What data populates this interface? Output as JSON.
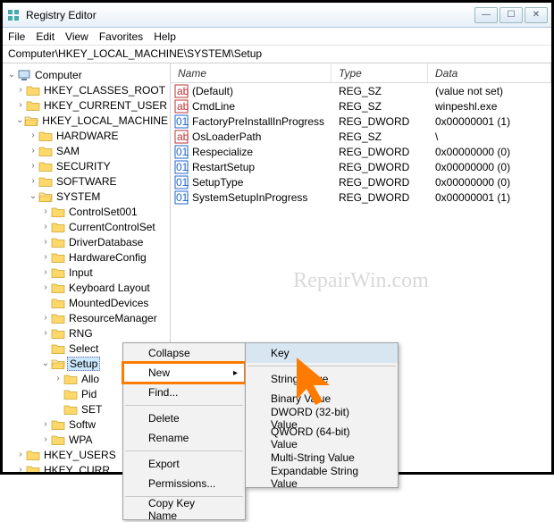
{
  "title": "Registry Editor",
  "menu": [
    "File",
    "Edit",
    "View",
    "Favorites",
    "Help"
  ],
  "path": "Computer\\HKEY_LOCAL_MACHINE\\SYSTEM\\Setup",
  "tree": {
    "root": "Computer",
    "k0": "HKEY_CLASSES_ROOT",
    "k1": "HKEY_CURRENT_USER",
    "k2": "HKEY_LOCAL_MACHINE",
    "k2a": "HARDWARE",
    "k2b": "SAM",
    "k2c": "SECURITY",
    "k2d": "SOFTWARE",
    "k2e": "SYSTEM",
    "s0": "ControlSet001",
    "s1": "CurrentControlSet",
    "s2": "DriverDatabase",
    "s3": "HardwareConfig",
    "s4": "Input",
    "s5": "Keyboard Layout",
    "s6": "MountedDevices",
    "s7": "ResourceManager",
    "s8": "RNG",
    "s9": "Select",
    "s10": "Setup",
    "s10a": "Allo",
    "s10b": "Pid",
    "s10c": "SET",
    "s11": "Softw",
    "s12": "WPA",
    "k3": "HKEY_USERS",
    "k4": "HKEY_CURR"
  },
  "cols": {
    "c1": "Name",
    "c2": "Type",
    "c3": "Data"
  },
  "rows": [
    {
      "ic": "str",
      "n": "(Default)",
      "t": "REG_SZ",
      "d": "(value not set)"
    },
    {
      "ic": "str",
      "n": "CmdLine",
      "t": "REG_SZ",
      "d": "winpeshl.exe"
    },
    {
      "ic": "bin",
      "n": "FactoryPreInstallInProgress",
      "t": "REG_DWORD",
      "d": "0x00000001 (1)"
    },
    {
      "ic": "str",
      "n": "OsLoaderPath",
      "t": "REG_SZ",
      "d": "\\"
    },
    {
      "ic": "bin",
      "n": "Respecialize",
      "t": "REG_DWORD",
      "d": "0x00000000 (0)"
    },
    {
      "ic": "bin",
      "n": "RestartSetup",
      "t": "REG_DWORD",
      "d": "0x00000000 (0)"
    },
    {
      "ic": "bin",
      "n": "SetupType",
      "t": "REG_DWORD",
      "d": "0x00000000 (0)"
    },
    {
      "ic": "bin",
      "n": "SystemSetupInProgress",
      "t": "REG_DWORD",
      "d": "0x00000001 (1)"
    }
  ],
  "ctx1": {
    "i0": "Collapse",
    "i1": "New",
    "i2": "Find...",
    "i3": "Delete",
    "i4": "Rename",
    "i5": "Export",
    "i6": "Permissions...",
    "i7": "Copy Key Name"
  },
  "ctx2": {
    "i0": "Key",
    "i1": "String Value",
    "i2": "Binary Value",
    "i3": "DWORD (32-bit) Value",
    "i4": "QWORD (64-bit) Value",
    "i5": "Multi-String Value",
    "i6": "Expandable String Value"
  },
  "watermark": "RepairWin.com"
}
